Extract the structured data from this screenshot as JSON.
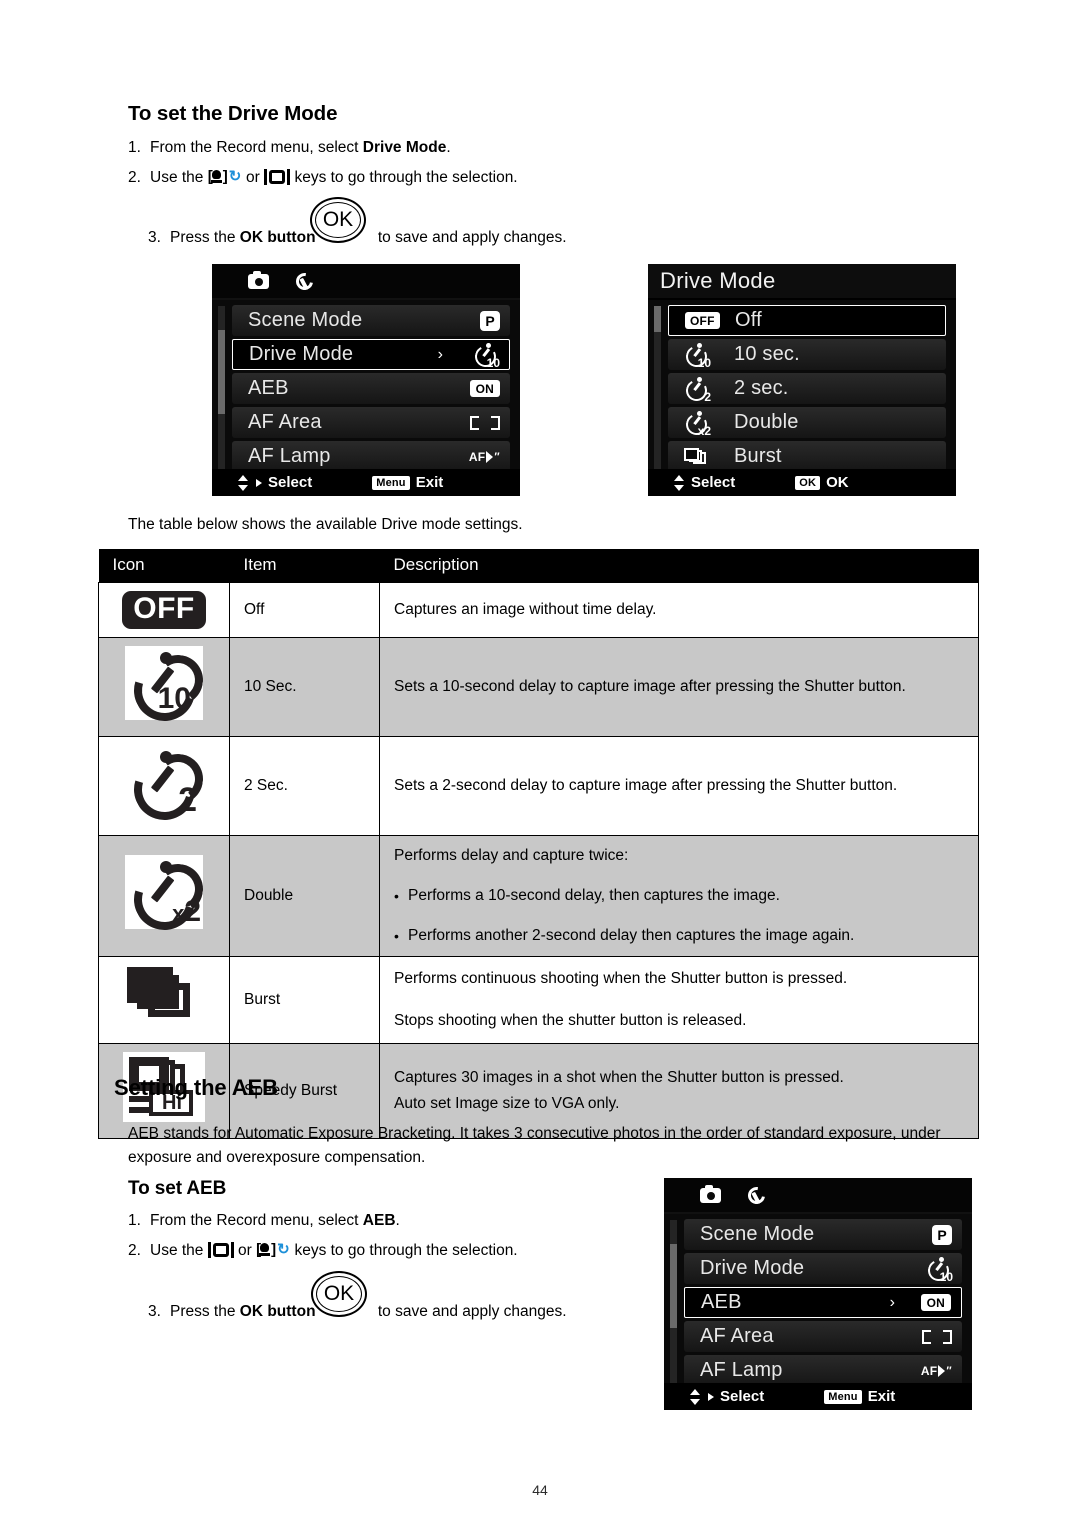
{
  "page": {
    "number": "44"
  },
  "section_drive": {
    "title": "To set the Drive Mode",
    "steps": [
      {
        "num": "1.",
        "before": "From the Record menu, select ",
        "bold": "Drive Mode",
        "after": "."
      },
      {
        "num": "2.",
        "before": "Use the ",
        "mid": " or ",
        "after": " keys to go through the selection."
      },
      {
        "num": "3.",
        "before": "Press the ",
        "bold": "OK button",
        "after": " to save and apply changes."
      }
    ],
    "ok_button_label": "OK",
    "table_intro": "The table below shows the available Drive mode settings."
  },
  "record_menu_screen": {
    "tabs": [
      "camera-icon",
      "wrench-icon"
    ],
    "rows": [
      {
        "label": "Scene Mode",
        "value_icon": "p-mode-badge",
        "selected": false,
        "chevron": ""
      },
      {
        "label": "Drive Mode",
        "value_icon": "timer-10-icon",
        "selected": true,
        "chevron": "›"
      },
      {
        "label": "AEB",
        "value_text": "ON",
        "selected": false,
        "chevron": ""
      },
      {
        "label": "AF Area",
        "value_icon": "af-area-icon",
        "selected": false,
        "chevron": ""
      },
      {
        "label": "AF Lamp",
        "value_icon": "af-lamp-icon",
        "selected": false,
        "chevron": ""
      }
    ],
    "footer": {
      "select_label": "Select",
      "action_badge": "Menu",
      "action_label": "Exit"
    }
  },
  "drive_mode_screen": {
    "title": "Drive Mode",
    "rows": [
      {
        "badge": "OFF",
        "label": "Off",
        "selected": true
      },
      {
        "icon": "timer-10-icon",
        "label": "10 sec.",
        "selected": false
      },
      {
        "icon": "timer-2-icon",
        "label": "2 sec.",
        "selected": false
      },
      {
        "icon": "timer-x2-icon",
        "label": "Double",
        "selected": false
      },
      {
        "icon": "burst-icon",
        "label": "Burst",
        "selected": false
      }
    ],
    "footer": {
      "select_label": "Select",
      "action_badge": "OK",
      "action_label": "OK"
    }
  },
  "drive_table": {
    "headers": [
      "Icon",
      "Item",
      "Description"
    ],
    "rows": [
      {
        "icon": "off-icon",
        "item": "Off",
        "desc_lines": [
          "Captures an image without time delay."
        ],
        "bullets": [],
        "alt": false
      },
      {
        "icon": "timer-10-icon",
        "item": "10 Sec.",
        "desc_lines": [
          "Sets a 10-second delay to capture image after pressing the Shutter button."
        ],
        "bullets": [],
        "alt": true
      },
      {
        "icon": "timer-2-icon",
        "item": "2 Sec.",
        "desc_lines": [
          "Sets a 2-second delay to capture image after pressing the Shutter button."
        ],
        "bullets": [],
        "alt": false
      },
      {
        "icon": "timer-x2-icon",
        "item": "Double",
        "desc_lines": [
          "Performs delay and capture twice:"
        ],
        "bullets": [
          "Performs a 10-second delay, then captures the image.",
          "Performs another 2-second delay then captures the image again."
        ],
        "alt": true
      },
      {
        "icon": "burst-icon",
        "item": "Burst",
        "desc_lines": [
          "Performs continuous shooting when the Shutter button is pressed.",
          "Stops shooting when the shutter button is released."
        ],
        "bullets": [],
        "alt": false
      },
      {
        "icon": "speedy-burst-icon",
        "item": "Speedy Burst",
        "desc_tight": [
          "Captures 30 images in a shot when the Shutter button is pressed.",
          "Auto set Image size to VGA only."
        ],
        "bullets": [],
        "alt": true
      }
    ]
  },
  "section_aeb": {
    "title": "Setting the AEB",
    "paragraph_line1": "AEB stands for Automatic Exposure Bracketing. It takes 3 consecutive photos in the order of standard exposure,",
    "paragraph_line2": "under exposure and overexposure compensation.",
    "subtitle": "To set AEB",
    "steps": [
      {
        "num": "1.",
        "before": "From the Record menu, select ",
        "bold": "AEB",
        "after": "."
      },
      {
        "num": "2.",
        "before": "Use the ",
        "mid": " or ",
        "after": " keys to go through the selection."
      },
      {
        "num": "3.",
        "before": "Press the ",
        "bold": "OK button",
        "after": " to save and apply changes."
      }
    ],
    "ok_button_label": "OK"
  },
  "aeb_menu_screen": {
    "rows": [
      {
        "label": "Scene Mode",
        "value_icon": "p-mode-badge",
        "selected": false,
        "chevron": ""
      },
      {
        "label": "Drive Mode",
        "value_icon": "timer-10-icon",
        "selected": false,
        "chevron": ""
      },
      {
        "label": "AEB",
        "value_text": "ON",
        "selected": true,
        "chevron": "›"
      },
      {
        "label": "AF Area",
        "value_icon": "af-area-icon",
        "selected": false,
        "chevron": ""
      },
      {
        "label": "AF Lamp",
        "value_icon": "af-lamp-icon",
        "selected": false,
        "chevron": ""
      }
    ],
    "footer": {
      "select_label": "Select",
      "action_badge": "Menu",
      "action_label": "Exit"
    }
  },
  "colors": {
    "accent_blue": "#1e90d8",
    "table_alt": "#c8c8c8",
    "lcd_bg": "#0a0a0a"
  }
}
